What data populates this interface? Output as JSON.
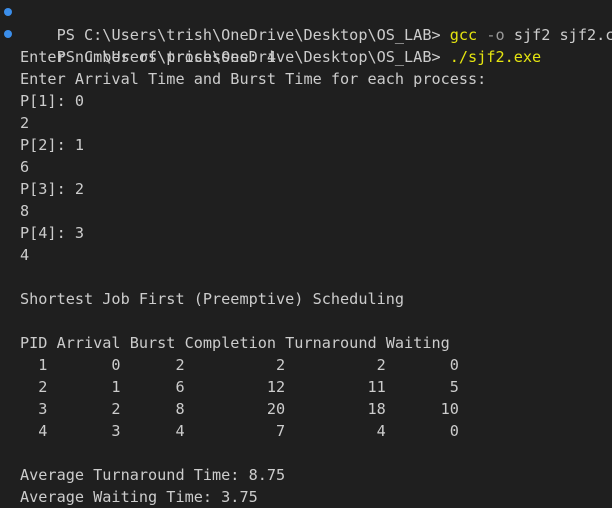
{
  "terminal": {
    "prompt_1": "PS C:\\Users\\trish\\OneDrive\\Desktop\\OS_LAB> ",
    "cmd_1_program": "gcc",
    "cmd_1_flag": "-o",
    "cmd_1_args": "sjf2 sjf2.c",
    "prompt_2": "PS C:\\Users\\trish\\OneDrive\\Desktop\\OS_LAB> ",
    "cmd_2_program": "./sjf2.exe",
    "output_lines": [
      "Enter number of processes: 4",
      "Enter Arrival Time and Burst Time for each process:",
      "P[1]: 0",
      "2",
      "P[2]: 1",
      "6",
      "P[3]: 2",
      "8",
      "P[4]: 3",
      "4",
      "",
      "Shortest Job First (Preemptive) Scheduling",
      "",
      "PID Arrival Burst Completion Turnaround Waiting",
      "  1       0      2          2          2       0",
      "  2       1      6         12         11       5",
      "  3       2      8         20         18      10",
      "  4       3      4          7          4       0",
      "",
      "Average Turnaround Time: 8.75",
      "Average Waiting Time: 3.75"
    ]
  }
}
